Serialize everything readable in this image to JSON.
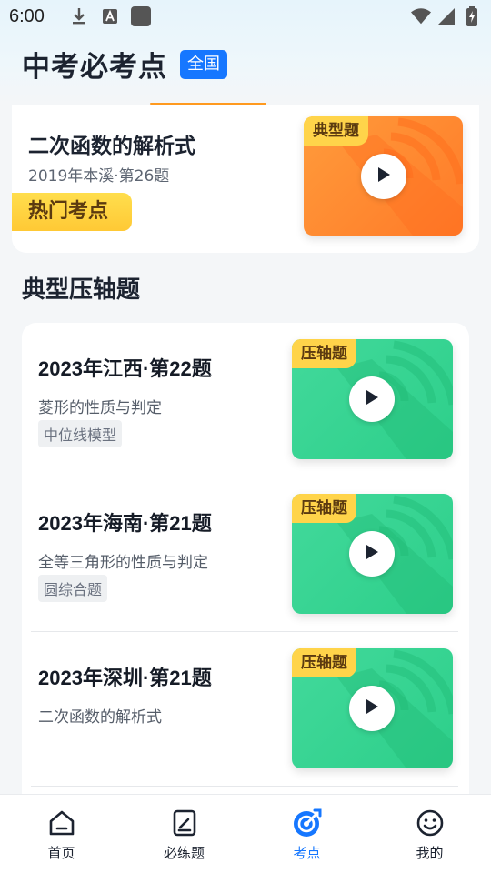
{
  "status_bar": {
    "time": "6:00",
    "icons": [
      "download-icon",
      "a-box-icon",
      "square-icon",
      "wifi-icon",
      "signal-icon",
      "battery-icon"
    ]
  },
  "header": {
    "title": "中考必考点",
    "region": "全国"
  },
  "featured": {
    "title": "二次函数的解析式",
    "subtitle": "2019年本溪·第26题",
    "hot_tag": "热门考点",
    "thumb_tag": "典型题",
    "thumb_color": "#ff8a30"
  },
  "section": {
    "title": "典型压轴题"
  },
  "items": [
    {
      "title": "2023年江西·第22题",
      "desc": "菱形的性质与判定",
      "tag": "中位线模型",
      "thumb_tag": "压轴题"
    },
    {
      "title": "2023年海南·第21题",
      "desc": "全等三角形的性质与判定",
      "tag": "圆综合题",
      "thumb_tag": "压轴题"
    },
    {
      "title": "2023年深圳·第21题",
      "desc": "二次函数的解析式",
      "tag": "",
      "thumb_tag": "压轴题"
    }
  ],
  "tabs": [
    {
      "label": "首页",
      "icon": "home-icon",
      "active": false
    },
    {
      "label": "必练题",
      "icon": "notebook-icon",
      "active": false
    },
    {
      "label": "考点",
      "icon": "target-icon",
      "active": true
    },
    {
      "label": "我的",
      "icon": "smiley-icon",
      "active": false
    }
  ],
  "colors": {
    "accent": "#1677ff",
    "green_thumb": "#34d391",
    "orange_thumb": "#ff8a30",
    "tag_yellow": "#ffd44a"
  }
}
